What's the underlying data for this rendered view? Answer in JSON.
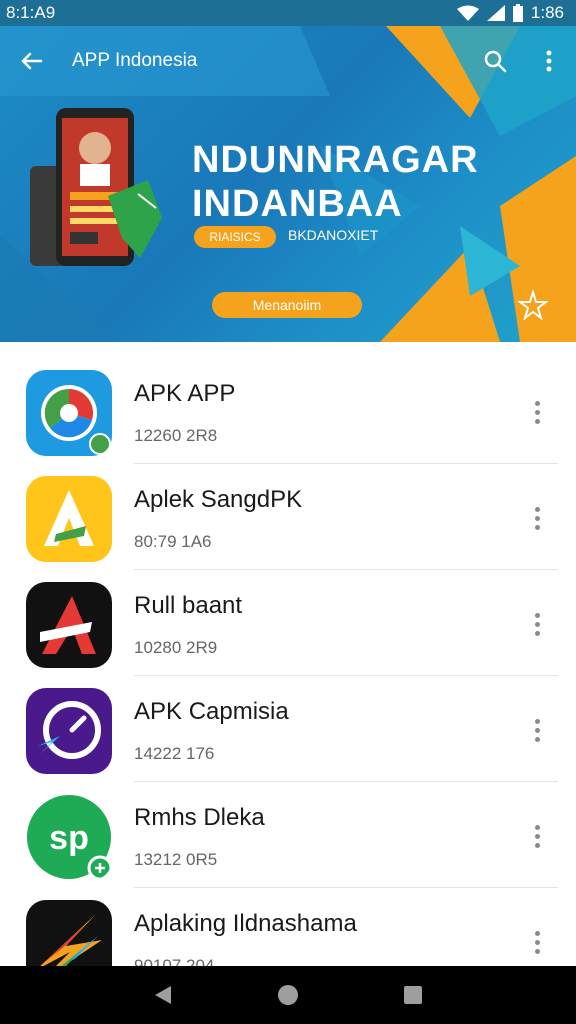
{
  "status_bar": {
    "time_left": "8:1:A9",
    "time_right": "1:86"
  },
  "app_bar": {
    "title": "APP Indonesia"
  },
  "banner": {
    "headline_1": "NDUNNRAGAR",
    "headline_2": "INDANBAA",
    "badge": "RIAISICS",
    "subtext": "BKDANOXIET",
    "cta": "Menanoiim"
  },
  "apps": [
    {
      "name": "APK APP",
      "meta": "12260 2R8"
    },
    {
      "name": "Aplek SangdPK",
      "meta": "80:79 1A6"
    },
    {
      "name": "Rull baant",
      "meta": "10280 2R9"
    },
    {
      "name": "APK Capmisia",
      "meta": "14222 176"
    },
    {
      "name": "Rmhs Dleka",
      "meta": "13212 0R5"
    },
    {
      "name": "Aplaking Ildnashama",
      "meta": "90107 204"
    }
  ],
  "icons": {
    "app_1": "colorful-circle-icon",
    "app_2": "yellow-a-icon",
    "app_3": "red-a-icon",
    "app_4": "purple-lightning-icon",
    "app_5": "green-sp-icon",
    "app_6": "rainbow-bolt-icon"
  },
  "colors": {
    "status_bar": "#1e6f96",
    "banner_blue": "#1a7fc0",
    "banner_accent": "#f5a21c",
    "nav_bar": "#000000"
  }
}
